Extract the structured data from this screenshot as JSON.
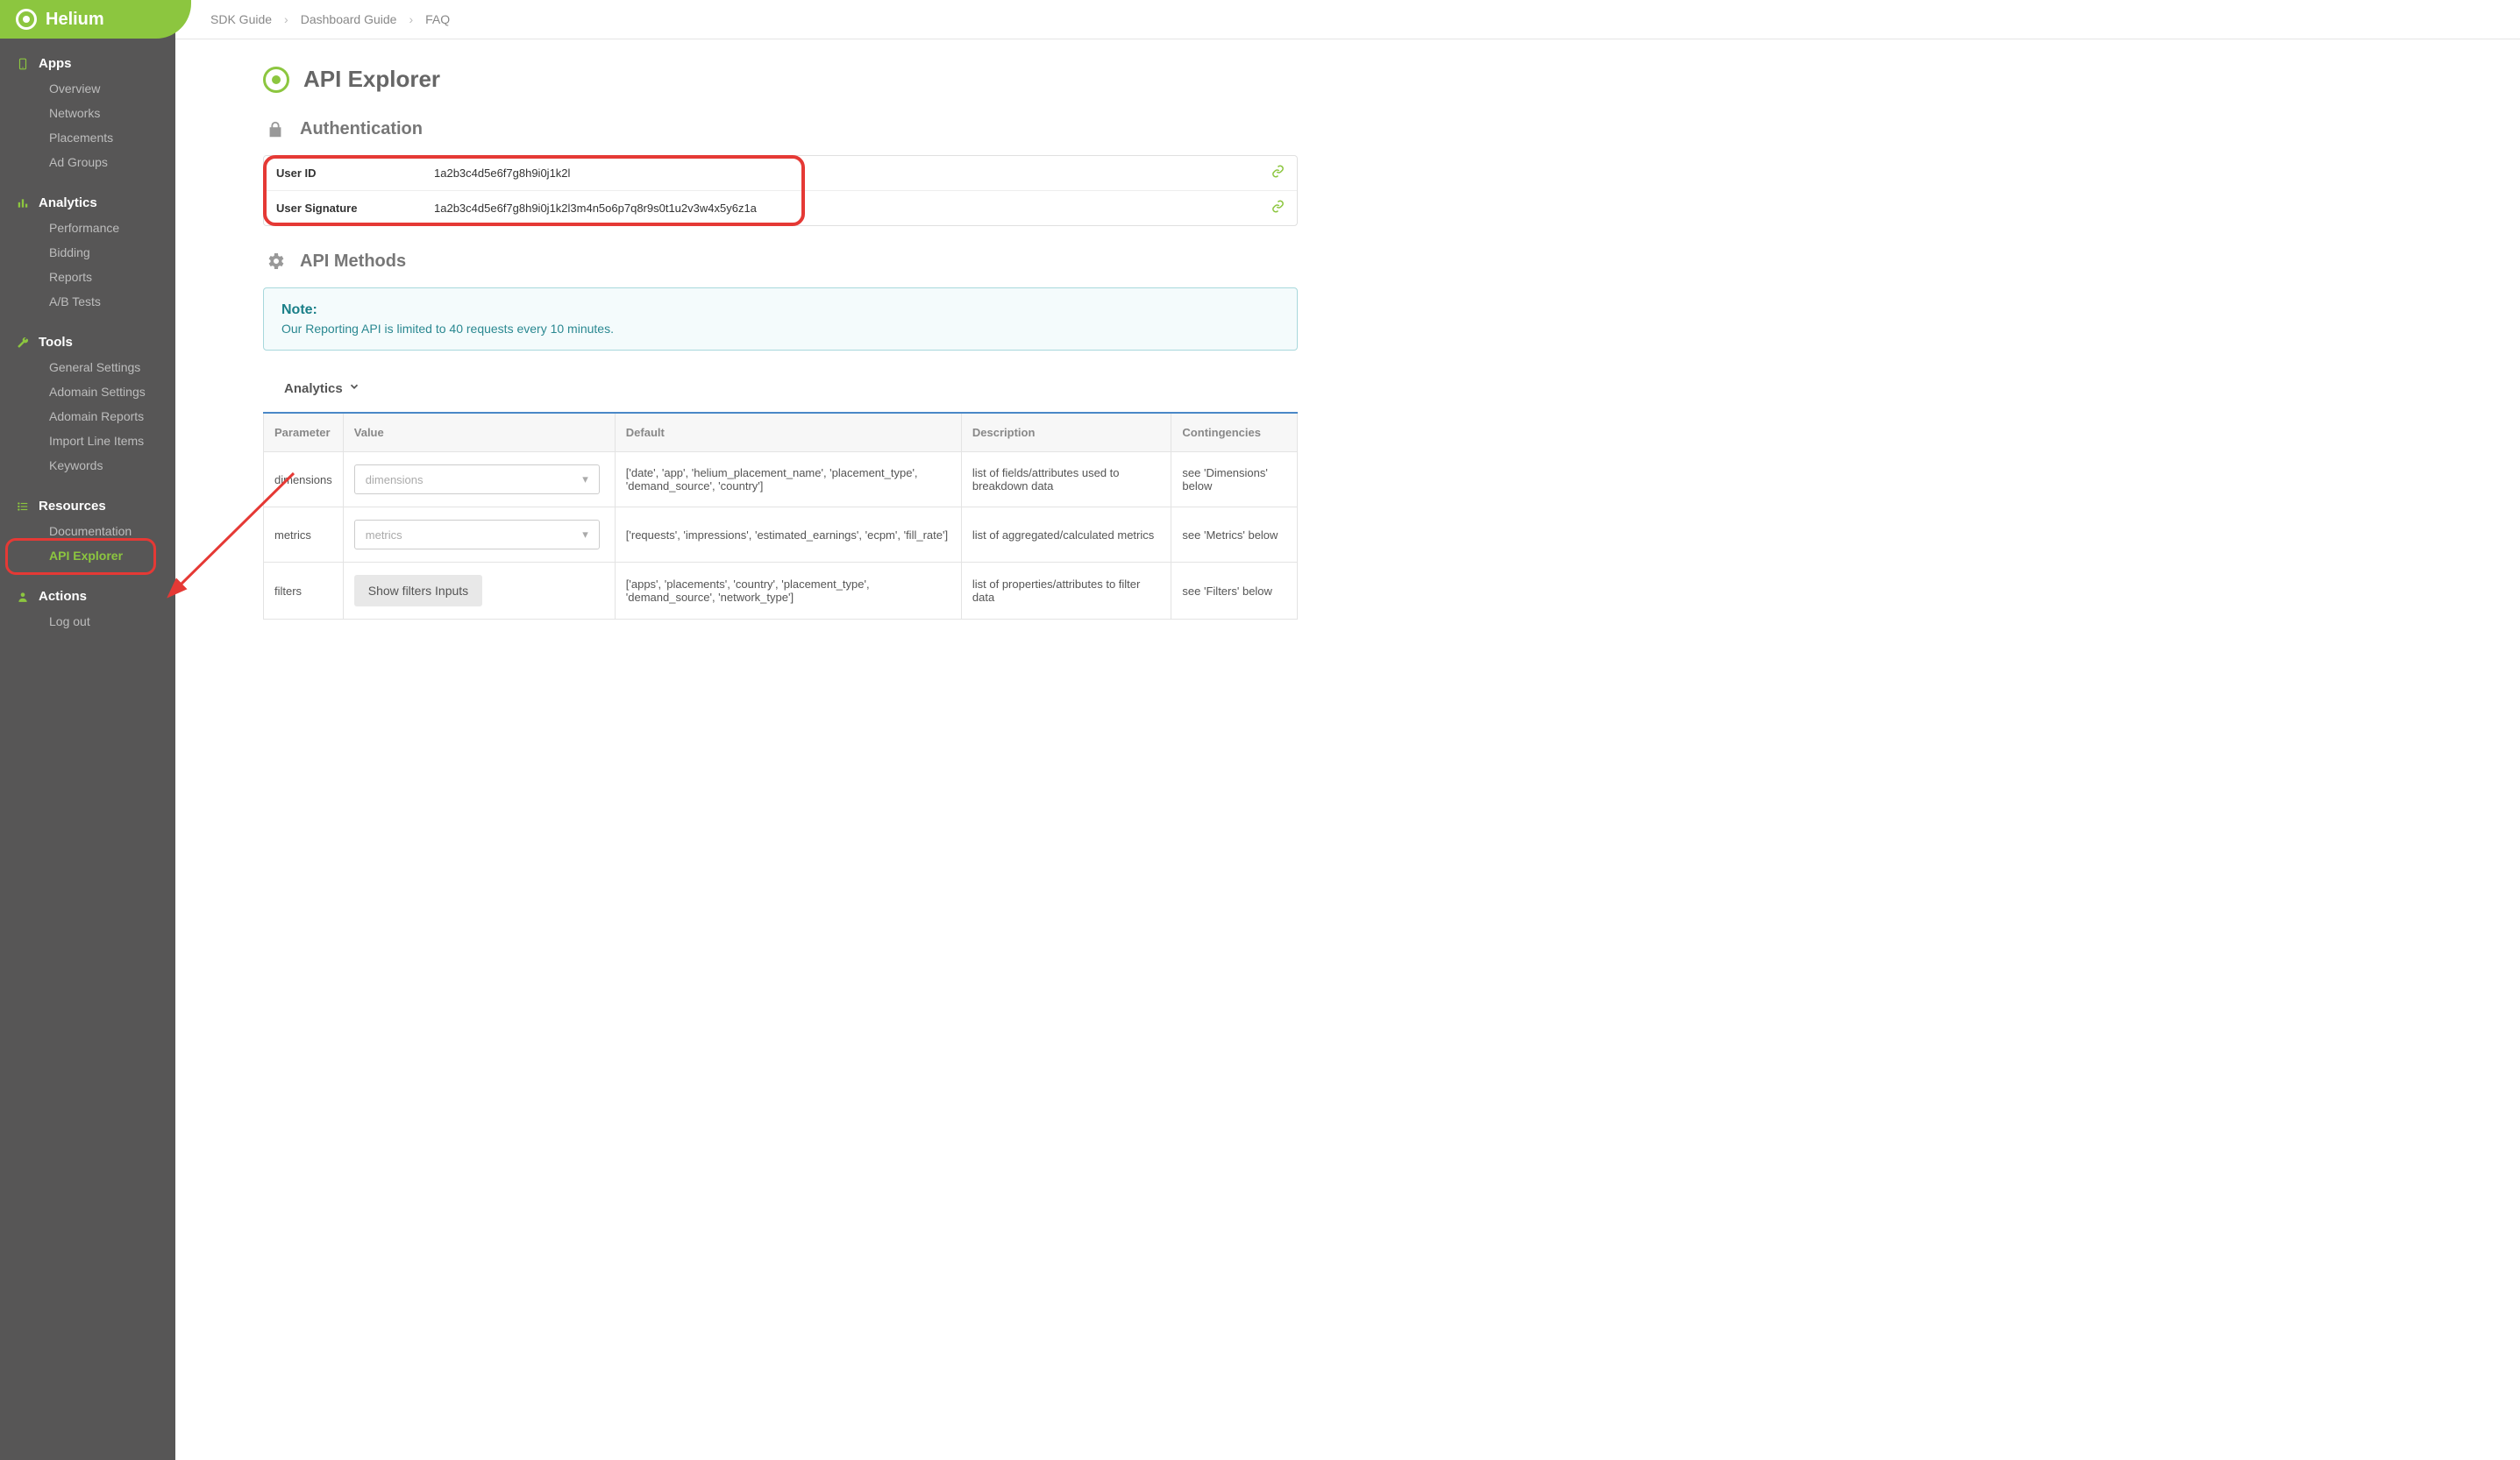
{
  "brand": "Helium",
  "breadcrumb": [
    "SDK Guide",
    "Dashboard Guide",
    "FAQ"
  ],
  "page_title": "API Explorer",
  "sidebar": {
    "sections": [
      {
        "title": "Apps",
        "icon": "phone",
        "items": [
          "Overview",
          "Networks",
          "Placements",
          "Ad Groups"
        ]
      },
      {
        "title": "Analytics",
        "icon": "bar",
        "items": [
          "Performance",
          "Bidding",
          "Reports",
          "A/B Tests"
        ]
      },
      {
        "title": "Tools",
        "icon": "wrench",
        "items": [
          "General Settings",
          "Adomain Settings",
          "Adomain Reports",
          "Import Line Items",
          "Keywords"
        ]
      },
      {
        "title": "Resources",
        "icon": "list",
        "items": [
          "Documentation",
          "API Explorer"
        ]
      },
      {
        "title": "Actions",
        "icon": "user",
        "items": [
          "Log out"
        ]
      }
    ],
    "active_item": "API Explorer"
  },
  "auth": {
    "section": "Authentication",
    "rows": [
      {
        "k": "User ID",
        "v": "1a2b3c4d5e6f7g8h9i0j1k2l"
      },
      {
        "k": "User Signature",
        "v": "1a2b3c4d5e6f7g8h9i0j1k2l3m4n5o6p7q8r9s0t1u2v3w4x5y6z1a"
      }
    ]
  },
  "methods": {
    "section": "API Methods",
    "note_title": "Note:",
    "note_body": "Our Reporting API is limited to 40 requests every 10 minutes.",
    "collapse_label": "Analytics"
  },
  "table": {
    "headers": [
      "Parameter",
      "Value",
      "Default",
      "Description",
      "Contingencies"
    ],
    "rows": [
      {
        "param": "dimensions",
        "value_placeholder": "dimensions",
        "value_type": "select",
        "default": "['date', 'app', 'helium_placement_name', 'placement_type', 'demand_source', 'country']",
        "desc": "list of fields/attributes used to breakdown data",
        "cont": "see 'Dimensions' below"
      },
      {
        "param": "metrics",
        "value_placeholder": "metrics",
        "value_type": "select",
        "default": "['requests', 'impressions', 'estimated_earnings', 'ecpm', 'fill_rate']",
        "desc": "list of aggregated/calculated metrics",
        "cont": "see 'Metrics' below"
      },
      {
        "param": "filters",
        "value_button": "Show filters Inputs",
        "value_type": "button",
        "default": "['apps', 'placements', 'country', 'placement_type', 'demand_source', 'network_type']",
        "desc": "list of properties/attributes to filter data",
        "cont": "see 'Filters' below"
      }
    ]
  }
}
